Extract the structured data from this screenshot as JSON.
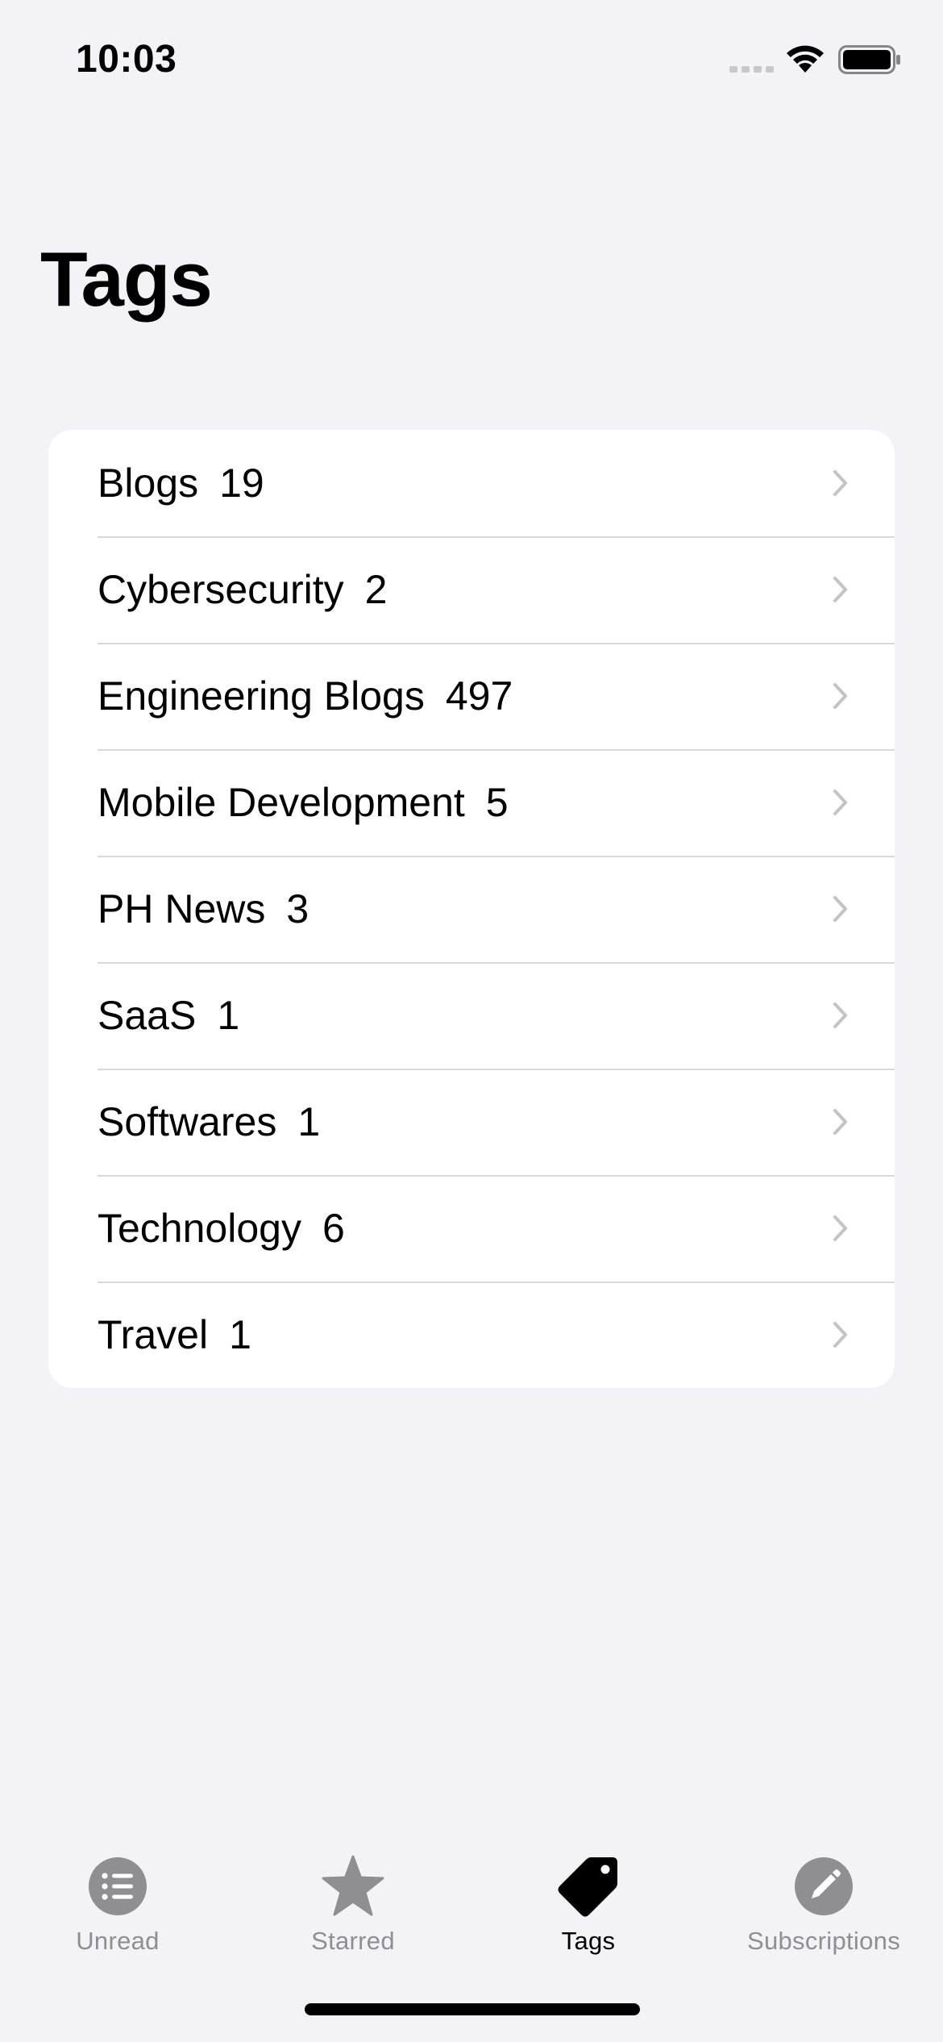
{
  "status_bar": {
    "time": "10:03",
    "icons": [
      "cellular-signal-icon",
      "wifi-icon",
      "battery-icon"
    ]
  },
  "page": {
    "title": "Tags"
  },
  "tags": [
    {
      "name": "Blogs",
      "count": "19"
    },
    {
      "name": "Cybersecurity",
      "count": "2"
    },
    {
      "name": "Engineering Blogs",
      "count": "497"
    },
    {
      "name": "Mobile Development",
      "count": "5"
    },
    {
      "name": "PH News",
      "count": "3"
    },
    {
      "name": "SaaS",
      "count": "1"
    },
    {
      "name": "Softwares",
      "count": "1"
    },
    {
      "name": "Technology",
      "count": "6"
    },
    {
      "name": "Travel",
      "count": "1"
    }
  ],
  "tab_bar": {
    "items": [
      {
        "label": "Unread",
        "icon": "list-bullet-circle-icon",
        "active": false
      },
      {
        "label": "Starred",
        "icon": "star-icon",
        "active": false
      },
      {
        "label": "Tags",
        "icon": "tag-icon",
        "active": true
      },
      {
        "label": "Subscriptions",
        "icon": "pencil-circle-icon",
        "active": false
      }
    ]
  },
  "colors": {
    "background": "#f2f2f7",
    "card": "#ffffff",
    "separator": "#d8d8dd",
    "chevron": "#c4c4c7",
    "inactive_tab": "#8e8e93",
    "active_tab": "#000000"
  }
}
